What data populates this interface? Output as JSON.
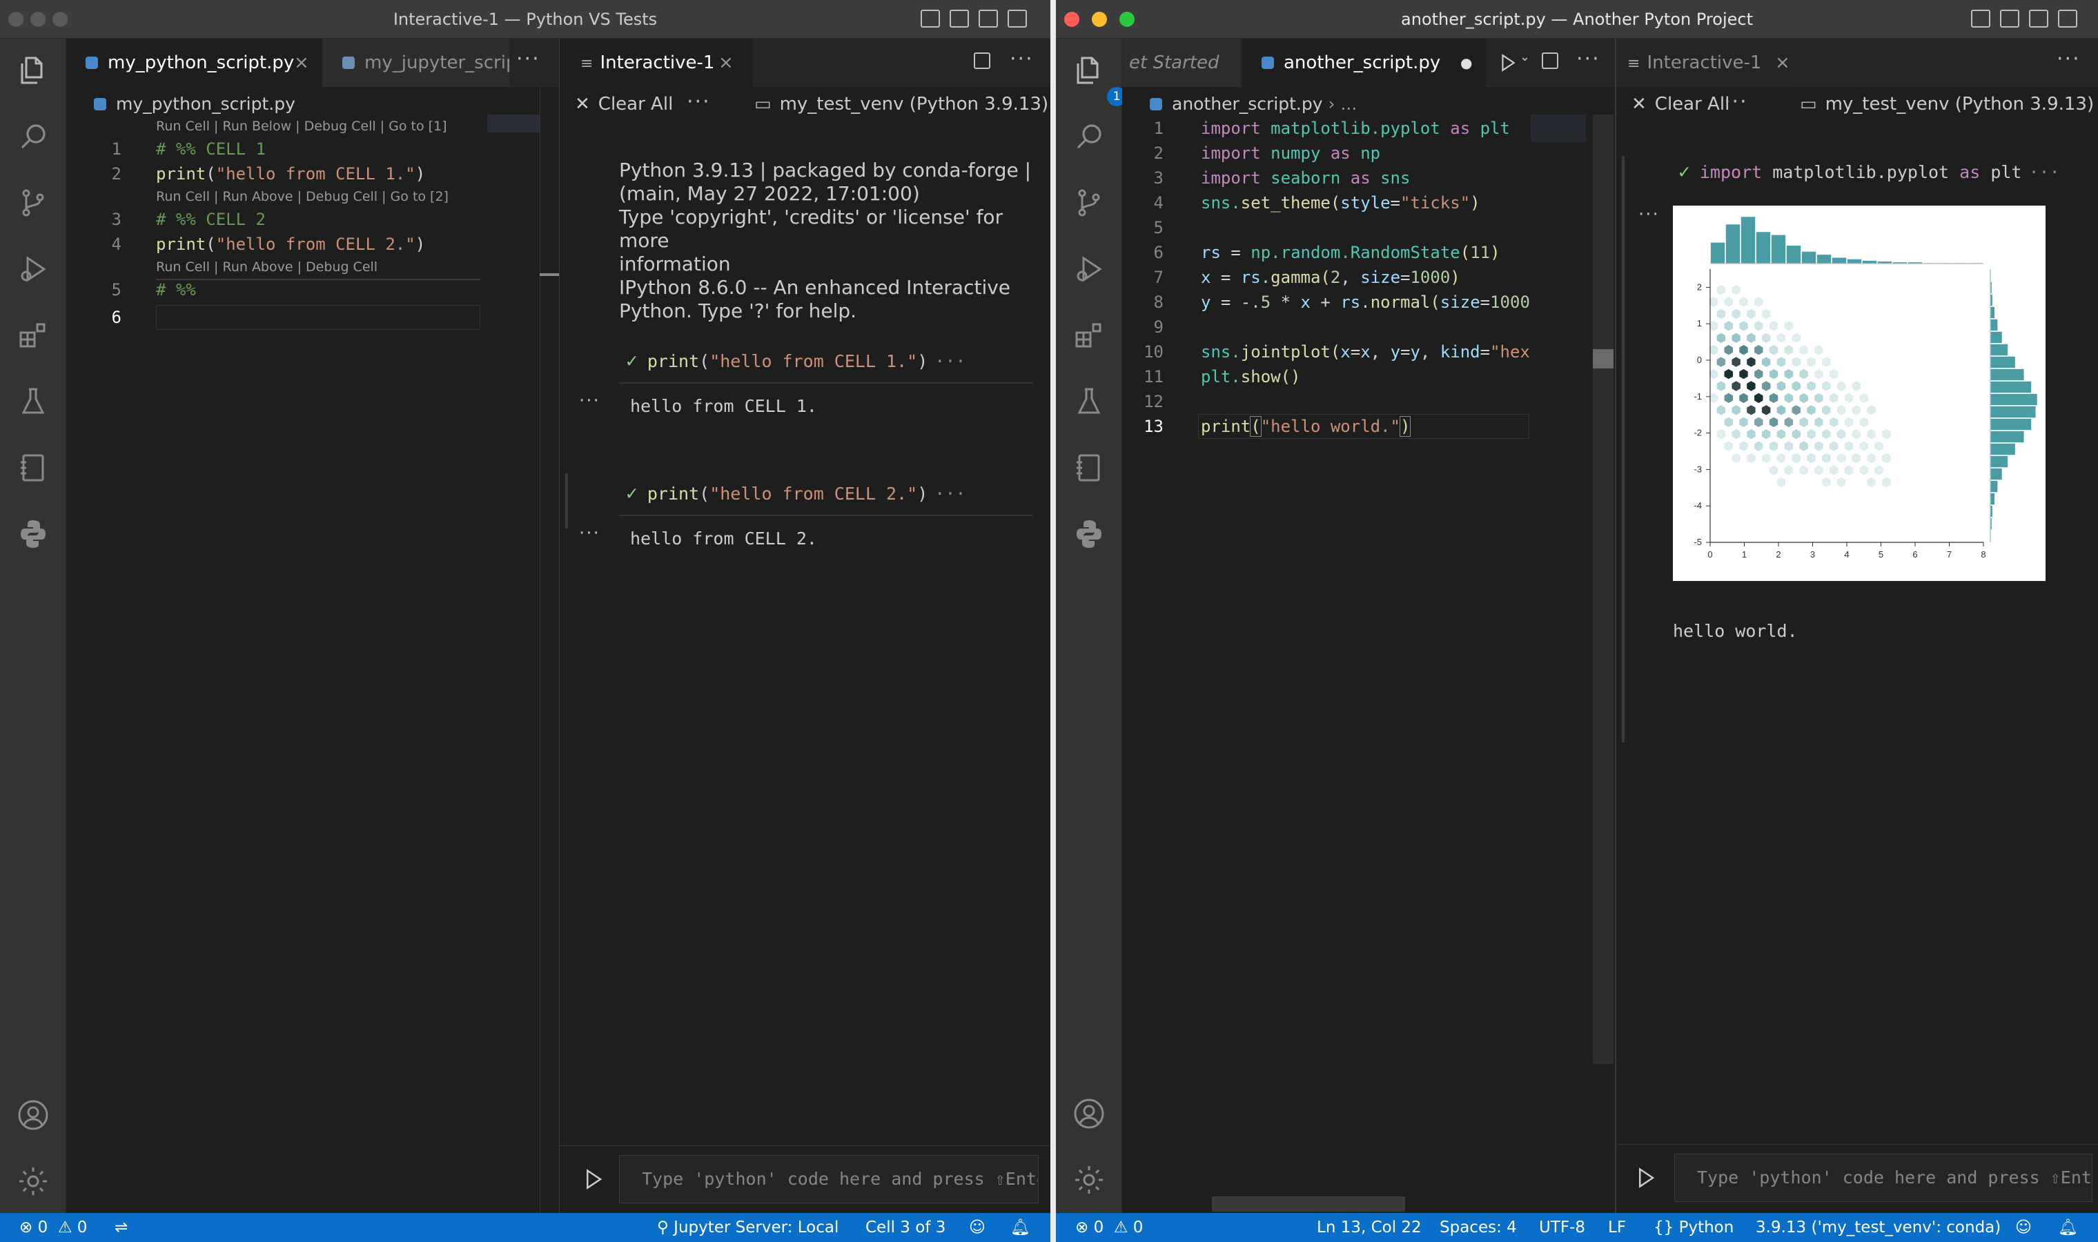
{
  "left_window": {
    "title": "Interactive-1 — Python VS Tests",
    "tabs": [
      {
        "label": "my_python_script.py",
        "close": "×"
      },
      {
        "label": "my_jupyter_scrip"
      }
    ],
    "breadcrumb": "my_python_script.py",
    "code_lens": [
      "Run Cell | Run Below | Debug Cell | Go to [1]",
      "Run Cell | Run Above | Debug Cell | Go to [2]",
      "Run Cell | Run Above | Debug Cell"
    ],
    "line_numbers": [
      "1",
      "2",
      "3",
      "4",
      "5",
      "6"
    ],
    "code": {
      "l1": "# %% CELL 1",
      "l2_fn": "print",
      "l2_open": "(",
      "l2_str": "\"hello from CELL 1.\"",
      "l2_close": ")",
      "l3": "# %% CELL 2",
      "l4_fn": "print",
      "l4_open": "(",
      "l4_str": "\"hello from CELL 2.\"",
      "l4_close": ")",
      "l5": "# %%"
    },
    "interactive": {
      "tab_label": "Interactive-1",
      "tab_close": "×",
      "clear_all": "Clear All",
      "kernel": "my_test_venv (Python 3.9.13)",
      "banner": [
        "Python 3.9.13 | packaged by conda-forge |",
        "(main, May 27 2022, 17:01:00)",
        "Type 'copyright', 'credits' or 'license' for more",
        "information",
        "IPython 8.6.0 -- An enhanced Interactive",
        "Python. Type '?' for help."
      ],
      "cells": [
        {
          "fn": "print",
          "open": "(",
          "str": "\"hello from CELL 1.\"",
          "close": ")",
          "ellipsis": "···",
          "output": "hello from CELL 1."
        },
        {
          "fn": "print",
          "open": "(",
          "str": "\"hello from CELL 2.\"",
          "close": ")",
          "ellipsis": "···",
          "output": "hello from CELL 2."
        }
      ],
      "input_placeholder": "Type 'python' code here and press ⇧Enter to run"
    },
    "status": {
      "errors": "0",
      "warnings": "0",
      "jupyter_server": "Jupyter Server: Local",
      "cell_pos": "Cell 3 of 3"
    }
  },
  "right_window": {
    "title": "another_script.py — Another Pyton Project",
    "explorer_badge": "1",
    "tabs": [
      {
        "label": "et Started"
      },
      {
        "label": "another_script.py",
        "modified": "●"
      }
    ],
    "breadcrumb": "another_script.py",
    "breadcrumb_more": "› ...",
    "line_numbers": [
      "1",
      "2",
      "3",
      "4",
      "5",
      "6",
      "7",
      "8",
      "9",
      "10",
      "11",
      "12",
      "13"
    ],
    "code": {
      "l1": [
        "import",
        " matplotlib.pyplot ",
        "as",
        " plt"
      ],
      "l2": [
        "import",
        " numpy ",
        "as",
        " np"
      ],
      "l3": [
        "import",
        " seaborn ",
        "as",
        " sns"
      ],
      "l4": [
        "sns.",
        "set_theme",
        "(",
        "style",
        "=",
        "\"ticks\"",
        ")"
      ],
      "l6": [
        "rs",
        " = ",
        "np.",
        "random.",
        "RandomState",
        "(",
        "11",
        ")"
      ],
      "l7": [
        "x",
        " = ",
        "rs.",
        "gamma",
        "(",
        "2",
        ", ",
        "size",
        "=",
        "1000",
        ")"
      ],
      "l8": [
        "y",
        " = -",
        ".5",
        " * ",
        "x",
        " + ",
        "rs.",
        "normal",
        "(",
        "size",
        "=",
        "1000"
      ],
      "l10": [
        "sns.",
        "jointplot",
        "(",
        "x",
        "=",
        "x",
        ", ",
        "y",
        "=",
        "y",
        ", ",
        "kind",
        "=",
        "\"hex"
      ],
      "l11": [
        "plt.",
        "show",
        "()"
      ],
      "l13": [
        "print",
        "(",
        "\"hello world.\"",
        ")"
      ]
    },
    "interactive": {
      "tab_label": "Interactive-1",
      "tab_close": "×",
      "clear_all": "Clear All",
      "kernel": "my_test_venv (Python 3.9.13)",
      "cell_kw": "import",
      "cell_rest": " matplotlib.pyplot ",
      "cell_as": "as",
      "cell_plt": " plt",
      "cell_ellipsis": "···",
      "output_text": "hello world.",
      "input_placeholder": "Type 'python' code here and press ⇧Enter to run"
    },
    "status": {
      "errors": "0",
      "warnings": "0",
      "position": "Ln 13, Col 22",
      "spaces": "Spaces: 4",
      "encoding": "UTF-8",
      "eol": "LF",
      "language": "Python",
      "interpreter": "3.9.13 ('my_test_venv': conda)"
    }
  },
  "chart_data": {
    "type": "heatmap",
    "subtype": "hexbin jointplot with marginal histograms",
    "xlim": [
      0,
      8
    ],
    "ylim": [
      -5,
      2.5
    ],
    "x_ticks": [
      "0",
      "1",
      "2",
      "3",
      "4",
      "5",
      "6",
      "7",
      "8"
    ],
    "y_ticks": [
      "2",
      "1",
      "0",
      "-1",
      "-2",
      "-3",
      "-4",
      "-5"
    ],
    "color": "#4b9da5",
    "grid": false,
    "density_peak": {
      "x": 1,
      "y": -1
    },
    "marginal_x_counts": [
      28,
      52,
      62,
      42,
      38,
      24,
      16,
      12,
      8,
      6,
      4,
      3,
      2,
      2,
      1,
      1,
      1,
      1
    ],
    "marginal_y_counts": [
      1,
      2,
      3,
      6,
      10,
      16,
      24,
      34,
      46,
      56,
      64,
      62,
      56,
      46,
      34,
      24,
      16,
      10,
      6,
      3,
      2,
      1
    ]
  },
  "colors": {
    "accent": "#0a6fc8",
    "editor_bg": "#1e1e1e",
    "activity_bg": "#333333",
    "plot": "#4b9da5"
  }
}
